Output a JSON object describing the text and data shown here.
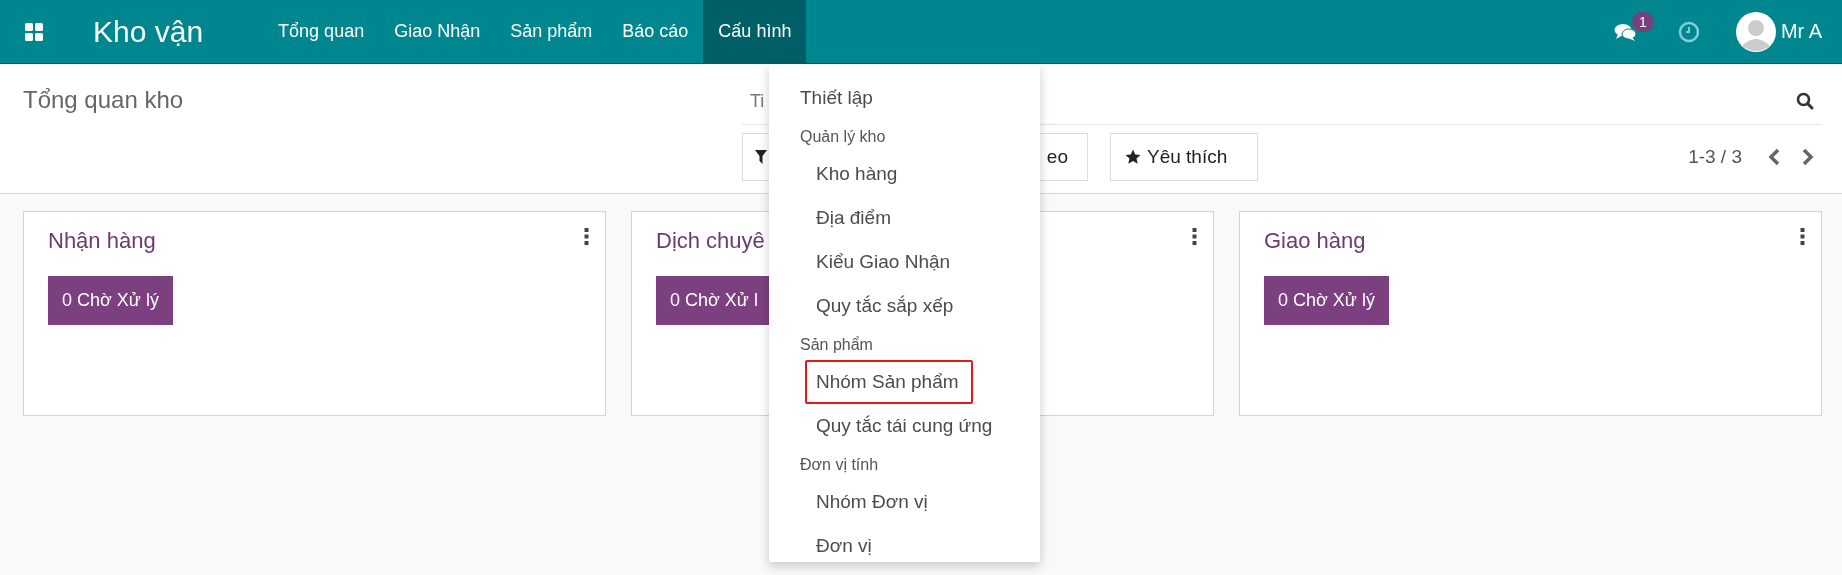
{
  "app": {
    "title": "Kho vận"
  },
  "menu": [
    {
      "label": "Tổng quan",
      "selected": false
    },
    {
      "label": "Giao Nhận",
      "selected": false
    },
    {
      "label": "Sản phẩm",
      "selected": false
    },
    {
      "label": "Báo cáo",
      "selected": false
    },
    {
      "label": "Cấu hình",
      "selected": true
    }
  ],
  "systray": {
    "badge": "1",
    "user": "Mr A"
  },
  "control_panel": {
    "title": "Tổng quan kho",
    "search": {
      "placeholder": "Ti"
    },
    "buttons": [
      {
        "kind": "filter"
      },
      {
        "kind": "group",
        "label": "eo"
      },
      {
        "kind": "favorites",
        "label": "Yêu thích"
      }
    ],
    "pager": "1-3 / 3"
  },
  "cards": [
    {
      "title": "Nhận hàng",
      "button": "0 Chờ Xử lý"
    },
    {
      "title": "Dịch chuyê",
      "button": "0 Chờ Xử l"
    },
    {
      "title": "Giao hàng",
      "button": "0 Chờ Xử lý"
    }
  ],
  "dropdown": [
    {
      "kind": "item",
      "label": "Thiết lập",
      "highlighted": false
    },
    {
      "kind": "section",
      "label": "Quản lý kho",
      "children": [
        {
          "label": "Kho hàng",
          "highlighted": false
        },
        {
          "label": "Địa điểm",
          "highlighted": false
        },
        {
          "label": "Kiểu Giao Nhận",
          "highlighted": false
        },
        {
          "label": "Quy tắc sắp xếp",
          "highlighted": false
        }
      ]
    },
    {
      "kind": "section",
      "label": "Sản phẩm",
      "children": [
        {
          "label": "Nhóm Sản phẩm",
          "highlighted": true
        },
        {
          "label": "Quy tắc tái cung ứng",
          "highlighted": false
        }
      ]
    },
    {
      "kind": "section",
      "label": "Đơn vị tính",
      "children": [
        {
          "label": "Nhóm Đơn vị",
          "highlighted": false
        },
        {
          "label": "Đơn vị",
          "highlighted": false
        }
      ]
    }
  ]
}
